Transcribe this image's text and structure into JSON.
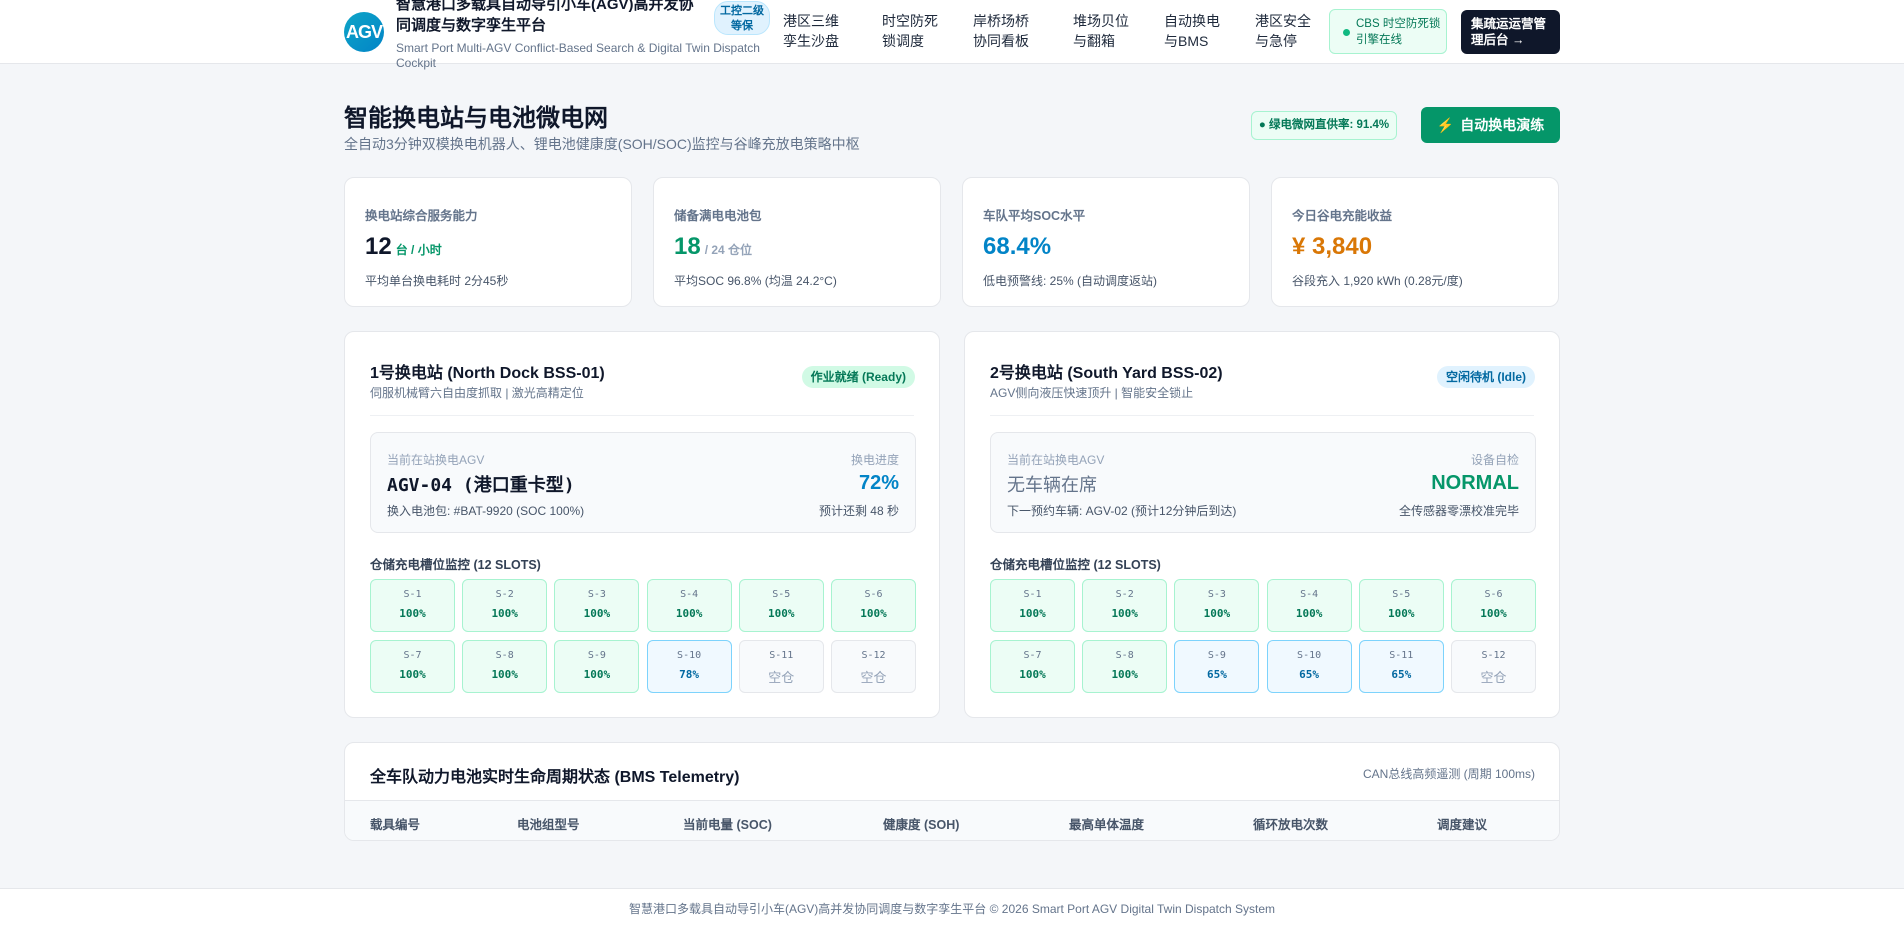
{
  "header": {
    "logo_text": "AGV",
    "title": "智慧港口多载具自动导引小车(AGV)高并发协同调度与数字孪生平台",
    "subtitle": "Smart Port Multi-AGV Conflict-Based Search & Digital Twin Dispatch Cockpit",
    "level_badge": "工控二级等保",
    "nav": [
      {
        "label": "港区三维孪生沙盘"
      },
      {
        "label": "时空防死锁调度"
      },
      {
        "label": "岸桥场桥协同看板"
      },
      {
        "label": "堆场贝位与翻箱"
      },
      {
        "label": "自动换电与BMS"
      },
      {
        "label": "港区安全与急停"
      }
    ],
    "cbs_badge": "CBS 时空防死锁引擎在线",
    "ops_button": "集疏运运营管理后台 →"
  },
  "page": {
    "title": "智能换电站与电池微电网",
    "subtitle": "全自动3分钟双模换电机器人、锂电池健康度(SOH/SOC)监控与谷峰充放电策略中枢",
    "green_rate": "● 绿电微网直供率: 91.4%",
    "drill_button": "自动换电演练",
    "bolt_icon": "⚡"
  },
  "kpis": [
    {
      "label": "换电站综合服务能力",
      "value": "12",
      "unit": "台 / 小时",
      "note": "平均单台换电耗时 2分45秒",
      "color": "#0f172a",
      "unit_color": "#059669"
    },
    {
      "label": "储备满电电池包",
      "value": "18",
      "unit": "/ 24 仓位",
      "note": "平均SOC 96.8% (均温 24.2°C)",
      "color": "#059669",
      "unit_color": "#94a3b8"
    },
    {
      "label": "车队平均SOC水平",
      "value": "68.4%",
      "unit": "",
      "note": "低电预警线: 25% (自动调度返站)",
      "color": "#0284c7",
      "unit_color": "#94a3b8"
    },
    {
      "label": "今日谷电充能收益",
      "value": "¥ 3,840",
      "unit": "",
      "note": "谷段充入 1,920 kWh (0.28元/度)",
      "color": "#d97706",
      "unit_color": "#94a3b8"
    }
  ],
  "stations": [
    {
      "title": "1号换电站 (North Dock BSS-01)",
      "subtitle": "伺服机械臂六自由度抓取 | 激光高精定位",
      "badge": "作业就绪 (Ready)",
      "badge_bg": "#d1fae5",
      "badge_color": "#047857",
      "current_label": "当前在站换电AGV",
      "current_value": "AGV-04 (港口重卡型)",
      "current_value_color": "#0f172a",
      "current_note": "换入电池包: #BAT-9920 (SOC 100%)",
      "right_label": "换电进度",
      "right_value": "72%",
      "right_value_color": "#0284c7",
      "right_note": "预计还剩 48 秒",
      "slots_title": "仓储充电槽位监控 (12 SLOTS)",
      "slots": [
        {
          "id": "S-1",
          "value": "100%",
          "state": "full"
        },
        {
          "id": "S-2",
          "value": "100%",
          "state": "full"
        },
        {
          "id": "S-3",
          "value": "100%",
          "state": "full"
        },
        {
          "id": "S-4",
          "value": "100%",
          "state": "full"
        },
        {
          "id": "S-5",
          "value": "100%",
          "state": "full"
        },
        {
          "id": "S-6",
          "value": "100%",
          "state": "full"
        },
        {
          "id": "S-7",
          "value": "100%",
          "state": "full"
        },
        {
          "id": "S-8",
          "value": "100%",
          "state": "full"
        },
        {
          "id": "S-9",
          "value": "100%",
          "state": "full"
        },
        {
          "id": "S-10",
          "value": "78%",
          "state": "charging"
        },
        {
          "id": "S-11",
          "value": "空仓",
          "state": "empty"
        },
        {
          "id": "S-12",
          "value": "空仓",
          "state": "empty"
        }
      ]
    },
    {
      "title": "2号换电站 (South Yard BSS-02)",
      "subtitle": "AGV侧向液压快速顶升 | 智能安全锁止",
      "badge": "空闲待机 (Idle)",
      "badge_bg": "#e0f2fe",
      "badge_color": "#0369a1",
      "current_label": "当前在站换电AGV",
      "current_value": "无车辆在席",
      "current_value_color": "#64748b",
      "current_note": "下一预约车辆: AGV-02 (预计12分钟后到达)",
      "right_label": "设备自检",
      "right_value": "NORMAL",
      "right_value_color": "#059669",
      "right_note": "全传感器零漂校准完毕",
      "slots_title": "仓储充电槽位监控 (12 SLOTS)",
      "slots": [
        {
          "id": "S-1",
          "value": "100%",
          "state": "full"
        },
        {
          "id": "S-2",
          "value": "100%",
          "state": "full"
        },
        {
          "id": "S-3",
          "value": "100%",
          "state": "full"
        },
        {
          "id": "S-4",
          "value": "100%",
          "state": "full"
        },
        {
          "id": "S-5",
          "value": "100%",
          "state": "full"
        },
        {
          "id": "S-6",
          "value": "100%",
          "state": "full"
        },
        {
          "id": "S-7",
          "value": "100%",
          "state": "full"
        },
        {
          "id": "S-8",
          "value": "100%",
          "state": "full"
        },
        {
          "id": "S-9",
          "value": "65%",
          "state": "charging"
        },
        {
          "id": "S-10",
          "value": "65%",
          "state": "charging"
        },
        {
          "id": "S-11",
          "value": "65%",
          "state": "charging"
        },
        {
          "id": "S-12",
          "value": "空仓",
          "state": "empty"
        }
      ]
    }
  ],
  "bms": {
    "title": "全车队动力电池实时生命周期状态 (BMS Telemetry)",
    "note": "CAN总线高频遥测 (周期 100ms)",
    "columns": [
      "载具编号",
      "电池组型号",
      "当前电量 (SOC)",
      "健康度 (SOH)",
      "最高单体温度",
      "循环放电次数",
      "调度建议"
    ]
  },
  "footer": {
    "text": "智慧港口多载具自动导引小车(AGV)高并发协同调度与数字孪生平台 © 2026 Smart Port AGV Digital Twin Dispatch System"
  }
}
